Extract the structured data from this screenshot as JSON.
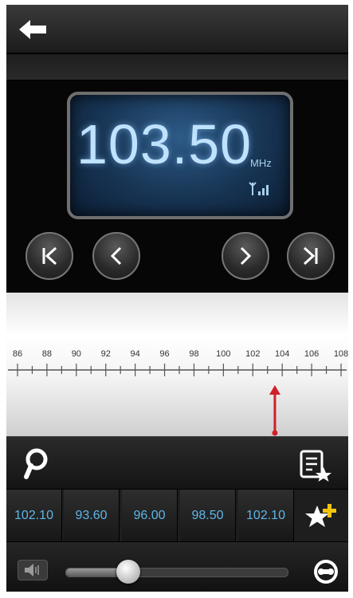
{
  "display": {
    "frequency": "103.50",
    "unit": "MHz"
  },
  "dial": {
    "scale_labels": [
      "86",
      "88",
      "90",
      "92",
      "94",
      "96",
      "98",
      "100",
      "102",
      "104",
      "106",
      "108"
    ],
    "min": 86,
    "max": 108,
    "indicator_value": 103.5
  },
  "presets": [
    {
      "label": "102.10"
    },
    {
      "label": "93.60"
    },
    {
      "label": "96.00"
    },
    {
      "label": "98.50"
    },
    {
      "label": "102.10"
    }
  ],
  "volume": {
    "level": 0.28
  },
  "icons": {
    "back": "back-arrow-icon",
    "seek_first": "skip-to-start-icon",
    "step_back": "chevron-left-icon",
    "step_forward": "chevron-right-icon",
    "seek_last": "skip-to-end-icon",
    "search": "search-icon",
    "favorites_list": "favorites-list-icon",
    "add_favorite": "add-favorite-icon",
    "speaker": "speaker-icon",
    "output": "audio-output-icon",
    "signal": "signal-strength-icon"
  },
  "colors": {
    "lcd_text": "#bfe2ff",
    "preset_text": "#5fb6e8",
    "indicator": "#d11f2a",
    "star": "#f1c40f"
  }
}
